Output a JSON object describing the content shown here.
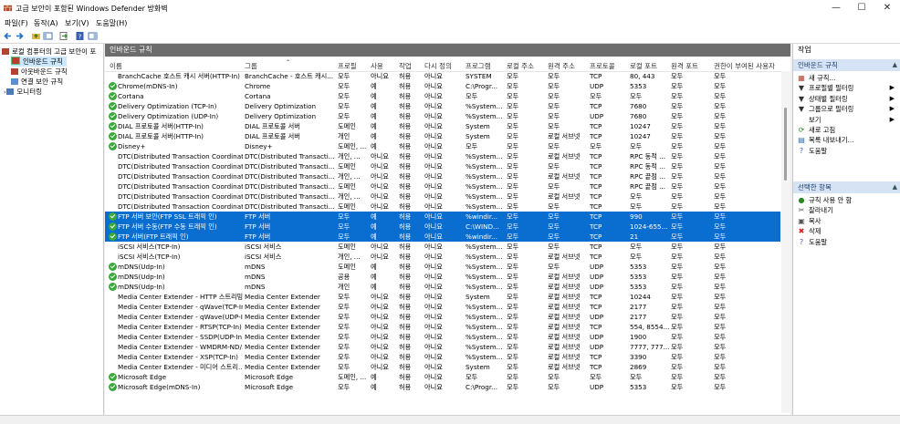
{
  "window": {
    "title": "고급 보안이 포함된 Windows Defender 방화벽",
    "controls": {
      "minimize": "—",
      "maximize": "☐",
      "close": "✕"
    }
  },
  "menu": [
    "파일(F)",
    "동작(A)",
    "보기(V)",
    "도움말(H)"
  ],
  "tree": {
    "root": "로컬 컴퓨터의 고급 보안이 포",
    "items": [
      "인바운드 규칙",
      "아웃바운드 규칙",
      "연결 보안 규칙",
      "모니터링"
    ]
  },
  "panel": {
    "title": "인바운드 규칙"
  },
  "columns": [
    "이름",
    "그룹",
    "프로필",
    "사용",
    "작업",
    "다시 정의",
    "프로그램",
    "로컬 주소",
    "원격 주소",
    "프로토콜",
    "로컬 포트",
    "원격 포트",
    "권한이 부여된 사용자"
  ],
  "rows": [
    {
      "enabled": false,
      "selected": false,
      "cells": [
        "BranchCache 호스트 캐시 서버(HTTP-In)",
        "BranchCache - 호스트 캐시...",
        "모두",
        "아니요",
        "허용",
        "아니요",
        "SYSTEM",
        "모두",
        "모두",
        "TCP",
        "80, 443",
        "모두",
        "모두"
      ]
    },
    {
      "enabled": true,
      "selected": false,
      "cells": [
        "Chrome(mDNS-In)",
        "Chrome",
        "모두",
        "예",
        "허용",
        "아니요",
        "C:\\Progr...",
        "모두",
        "모두",
        "UDP",
        "5353",
        "모두",
        "모두"
      ]
    },
    {
      "enabled": true,
      "selected": false,
      "cells": [
        "Cortana",
        "Cortana",
        "모두",
        "예",
        "허용",
        "아니요",
        "모두",
        "모두",
        "모두",
        "모두",
        "모두",
        "모두",
        "모두"
      ]
    },
    {
      "enabled": true,
      "selected": false,
      "cells": [
        "Delivery Optimization (TCP-In)",
        "Delivery Optimization",
        "모두",
        "예",
        "허용",
        "아니요",
        "%System...",
        "모두",
        "모두",
        "TCP",
        "7680",
        "모두",
        "모두"
      ]
    },
    {
      "enabled": true,
      "selected": false,
      "cells": [
        "Delivery Optimization (UDP-In)",
        "Delivery Optimization",
        "모두",
        "예",
        "허용",
        "아니요",
        "%System...",
        "모두",
        "모두",
        "UDP",
        "7680",
        "모두",
        "모두"
      ]
    },
    {
      "enabled": true,
      "selected": false,
      "cells": [
        "DIAL 프로토콜 서버(HTTP-In)",
        "DIAL 프로토콜 서버",
        "도메인",
        "예",
        "허용",
        "아니요",
        "System",
        "모두",
        "모두",
        "TCP",
        "10247",
        "모두",
        "모두"
      ]
    },
    {
      "enabled": true,
      "selected": false,
      "cells": [
        "DIAL 프로토콜 서버(HTTP-In)",
        "DIAL 프로토콜 서버",
        "개인",
        "예",
        "허용",
        "아니요",
        "System",
        "모두",
        "로컬 서브넷",
        "TCP",
        "10247",
        "모두",
        "모두"
      ]
    },
    {
      "enabled": true,
      "selected": false,
      "cells": [
        "Disney+",
        "Disney+",
        "도메인, ...",
        "예",
        "허용",
        "아니요",
        "모두",
        "모두",
        "모두",
        "모두",
        "모두",
        "모두",
        "모두"
      ]
    },
    {
      "enabled": false,
      "selected": false,
      "cells": [
        "DTC(Distributed Transaction Coordinato...",
        "DTC(Distributed Transacti...",
        "개인, ...",
        "아니요",
        "허용",
        "아니요",
        "%System...",
        "모두",
        "로컬 서브넷",
        "TCP",
        "RPC 동적 ...",
        "모두",
        "모두"
      ]
    },
    {
      "enabled": false,
      "selected": false,
      "cells": [
        "DTC(Distributed Transaction Coordinato...",
        "DTC(Distributed Transacti...",
        "도메인",
        "아니요",
        "허용",
        "아니요",
        "%System...",
        "모두",
        "모두",
        "TCP",
        "RPC 동적 ...",
        "모두",
        "모두"
      ]
    },
    {
      "enabled": false,
      "selected": false,
      "cells": [
        "DTC(Distributed Transaction Coordinato...",
        "DTC(Distributed Transacti...",
        "개인, ...",
        "아니요",
        "허용",
        "아니요",
        "%System...",
        "모두",
        "로컬 서브넷",
        "TCP",
        "RPC 끝점 ...",
        "모두",
        "모두"
      ]
    },
    {
      "enabled": false,
      "selected": false,
      "cells": [
        "DTC(Distributed Transaction Coordinato...",
        "DTC(Distributed Transacti...",
        "도메인",
        "아니요",
        "허용",
        "아니요",
        "%System...",
        "모두",
        "모두",
        "TCP",
        "RPC 끝점 ...",
        "모두",
        "모두"
      ]
    },
    {
      "enabled": false,
      "selected": false,
      "cells": [
        "DTC(Distributed Transaction Coordinato...",
        "DTC(Distributed Transacti...",
        "개인, ...",
        "아니요",
        "허용",
        "아니요",
        "%System...",
        "모두",
        "로컬 서브넷",
        "TCP",
        "모두",
        "모두",
        "모두"
      ]
    },
    {
      "enabled": false,
      "selected": false,
      "cells": [
        "DTC(Distributed Transaction Coordinato...",
        "DTC(Distributed Transacti...",
        "도메인",
        "아니요",
        "허용",
        "아니요",
        "%System...",
        "모두",
        "모두",
        "TCP",
        "모두",
        "모두",
        "모두"
      ]
    },
    {
      "enabled": true,
      "selected": true,
      "cells": [
        "FTP 서버 보안(FTP SSL 트래픽 인)",
        "FTP 서버",
        "모두",
        "예",
        "허용",
        "아니요",
        "%windir...",
        "모두",
        "모두",
        "TCP",
        "990",
        "모두",
        "모두"
      ]
    },
    {
      "enabled": true,
      "selected": true,
      "cells": [
        "FTP 서버 수동(FTP 수동 트래픽 인)",
        "FTP 서버",
        "모두",
        "예",
        "허용",
        "아니요",
        "C:\\WIND...",
        "모두",
        "모두",
        "TCP",
        "1024-655...",
        "모두",
        "모두"
      ]
    },
    {
      "enabled": true,
      "selected": true,
      "cells": [
        "FTP 서버(FTP 트래픽 인)",
        "FTP 서버",
        "모두",
        "예",
        "허용",
        "아니요",
        "%windir...",
        "모두",
        "모두",
        "TCP",
        "21",
        "모두",
        "모두"
      ]
    },
    {
      "enabled": false,
      "selected": false,
      "cells": [
        "iSCSI 서비스(TCP-In)",
        "iSCSI 서비스",
        "도메인",
        "아니요",
        "허용",
        "아니요",
        "%System...",
        "모두",
        "모두",
        "TCP",
        "모두",
        "모두",
        "모두"
      ]
    },
    {
      "enabled": false,
      "selected": false,
      "cells": [
        "iSCSI 서비스(TCP-In)",
        "iSCSI 서비스",
        "개인, ...",
        "아니요",
        "허용",
        "아니요",
        "%System...",
        "모두",
        "로컬 서브넷",
        "TCP",
        "모두",
        "모두",
        "모두"
      ]
    },
    {
      "enabled": true,
      "selected": false,
      "cells": [
        "mDNS(Udp-In)",
        "mDNS",
        "도메인",
        "예",
        "허용",
        "아니요",
        "%System...",
        "모두",
        "모두",
        "UDP",
        "5353",
        "모두",
        "모두"
      ]
    },
    {
      "enabled": true,
      "selected": false,
      "cells": [
        "mDNS(Udp-In)",
        "mDNS",
        "공용",
        "예",
        "허용",
        "아니요",
        "%System...",
        "모두",
        "로컬 서브넷",
        "UDP",
        "5353",
        "모두",
        "모두"
      ]
    },
    {
      "enabled": true,
      "selected": false,
      "cells": [
        "mDNS(Udp-In)",
        "mDNS",
        "개인",
        "예",
        "허용",
        "아니요",
        "%System...",
        "모두",
        "로컬 서브넷",
        "UDP",
        "5353",
        "모두",
        "모두"
      ]
    },
    {
      "enabled": false,
      "selected": false,
      "cells": [
        "Media Center Extender - HTTP 스트리밍...",
        "Media Center Extender",
        "모두",
        "아니요",
        "허용",
        "아니요",
        "System",
        "모두",
        "로컬 서브넷",
        "TCP",
        "10244",
        "모두",
        "모두"
      ]
    },
    {
      "enabled": false,
      "selected": false,
      "cells": [
        "Media Center Extender - qWave(TCP-In)",
        "Media Center Extender",
        "모두",
        "아니요",
        "허용",
        "아니요",
        "%System...",
        "모두",
        "로컬 서브넷",
        "TCP",
        "2177",
        "모두",
        "모두"
      ]
    },
    {
      "enabled": false,
      "selected": false,
      "cells": [
        "Media Center Extender - qWave(UDP-In)",
        "Media Center Extender",
        "모두",
        "아니요",
        "허용",
        "아니요",
        "%System...",
        "모두",
        "로컬 서브넷",
        "UDP",
        "2177",
        "모두",
        "모두"
      ]
    },
    {
      "enabled": false,
      "selected": false,
      "cells": [
        "Media Center Extender - RTSP(TCP-In)",
        "Media Center Extender",
        "모두",
        "아니요",
        "허용",
        "아니요",
        "%System...",
        "모두",
        "로컬 서브넷",
        "TCP",
        "554, 8554...",
        "모두",
        "모두"
      ]
    },
    {
      "enabled": false,
      "selected": false,
      "cells": [
        "Media Center Extender - SSDP(UDP-In)",
        "Media Center Extender",
        "모두",
        "아니요",
        "허용",
        "아니요",
        "%System...",
        "모두",
        "로컬 서브넷",
        "UDP",
        "1900",
        "모두",
        "모두"
      ]
    },
    {
      "enabled": false,
      "selected": false,
      "cells": [
        "Media Center Extender - WMDRM-ND/...",
        "Media Center Extender",
        "모두",
        "아니요",
        "허용",
        "아니요",
        "%System...",
        "모두",
        "로컬 서브넷",
        "UDP",
        "7777, 777...",
        "모두",
        "모두"
      ]
    },
    {
      "enabled": false,
      "selected": false,
      "cells": [
        "Media Center Extender - XSP(TCP-In)",
        "Media Center Extender",
        "모두",
        "아니요",
        "허용",
        "아니요",
        "%System...",
        "모두",
        "로컬 서브넷",
        "TCP",
        "3390",
        "모두",
        "모두"
      ]
    },
    {
      "enabled": false,
      "selected": false,
      "cells": [
        "Media Center Extender - 미디어 스트리...",
        "Media Center Extender",
        "모두",
        "아니요",
        "허용",
        "아니요",
        "System",
        "모두",
        "로컬 서브넷",
        "TCP",
        "2869",
        "모두",
        "모두"
      ]
    },
    {
      "enabled": true,
      "selected": false,
      "cells": [
        "Microsoft Edge",
        "Microsoft Edge",
        "도메인, ...",
        "예",
        "허용",
        "아니요",
        "모두",
        "모두",
        "모두",
        "모두",
        "모두",
        "모두",
        "모두"
      ]
    },
    {
      "enabled": true,
      "selected": false,
      "cells": [
        "Microsoft Edge(mDNS-In)",
        "Microsoft Edge",
        "모두",
        "예",
        "허용",
        "아니요",
        "C:\\Progr...",
        "모두",
        "모두",
        "UDP",
        "5353",
        "모두",
        "모두"
      ]
    }
  ],
  "actions": {
    "title": "작업",
    "section1": "인바운드 규칙",
    "items1": [
      {
        "icon": "new-rule-icon",
        "label": "새 규칙..."
      },
      {
        "icon": "filter-icon",
        "label": "프로필별 필터링",
        "submenu": true
      },
      {
        "icon": "filter-icon",
        "label": "상태별 필터링",
        "submenu": true
      },
      {
        "icon": "filter-icon",
        "label": "그룹으로 필터링",
        "submenu": true
      },
      {
        "icon": "view-icon",
        "label": "보기",
        "submenu": true
      },
      {
        "icon": "refresh-icon",
        "label": "새로 고침"
      },
      {
        "icon": "export-icon",
        "label": "목록 내보내기..."
      },
      {
        "icon": "help-icon",
        "label": "도움말"
      }
    ],
    "section2": "선택한 항목",
    "items2": [
      {
        "icon": "disable-rule-icon",
        "label": "규칙 사용 안 함"
      },
      {
        "icon": "cut-icon",
        "label": "잘라내기"
      },
      {
        "icon": "copy-icon",
        "label": "복사"
      },
      {
        "icon": "delete-icon",
        "label": "삭제"
      },
      {
        "icon": "help-icon",
        "label": "도움말"
      }
    ]
  }
}
